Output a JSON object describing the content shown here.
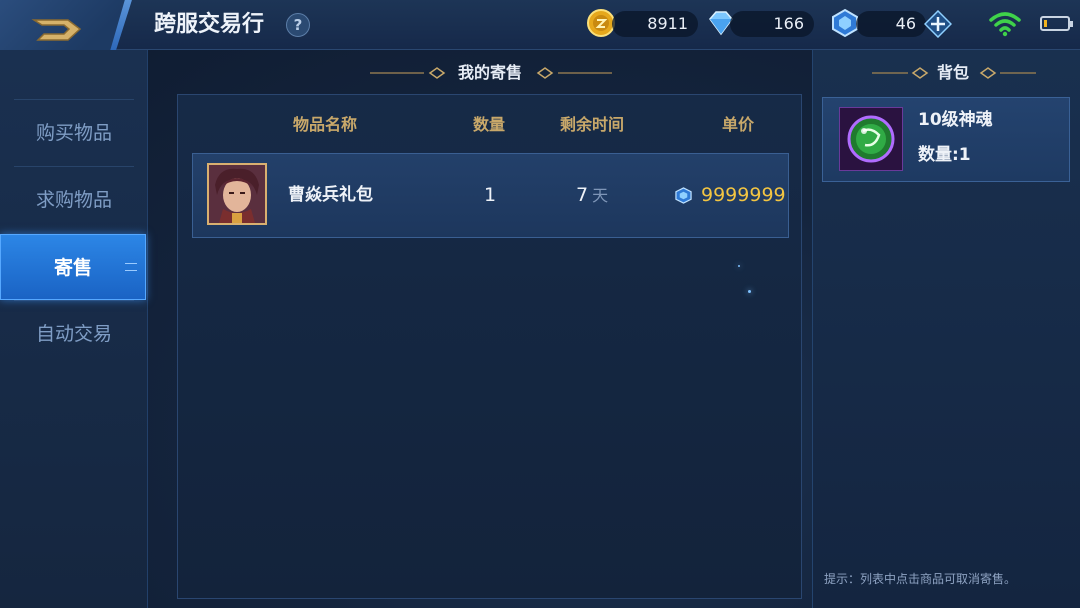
{
  "header": {
    "title": "跨服交易行",
    "help_label": "?",
    "currencies": [
      {
        "name": "gold-coin",
        "value": "8911"
      },
      {
        "name": "diamond",
        "value": "166"
      },
      {
        "name": "gem-coupon",
        "value": "46"
      }
    ],
    "battery_level": 0.15
  },
  "sidebar": {
    "items": [
      {
        "label": "购买物品",
        "active": false
      },
      {
        "label": "求购物品",
        "active": false
      },
      {
        "label": "寄售",
        "active": true
      },
      {
        "label": "自动交易",
        "active": false
      }
    ]
  },
  "main": {
    "section_title": "我的寄售",
    "columns": [
      "物品名称",
      "数量",
      "剩余时间",
      "单价"
    ],
    "rows": [
      {
        "name": "曹焱兵礼包",
        "quantity": "1",
        "time_value": "7",
        "time_unit": "天",
        "price": "9999999"
      }
    ]
  },
  "bag": {
    "section_title": "背包",
    "items": [
      {
        "name": "10级神魂",
        "quantity_label": "数量:1"
      }
    ],
    "hint": "提示：列表中点击商品可取消寄售。"
  },
  "colors": {
    "accent_blue": "#2c86e6",
    "gold_text": "#f3c542",
    "header_gold": "#c8a86a"
  }
}
